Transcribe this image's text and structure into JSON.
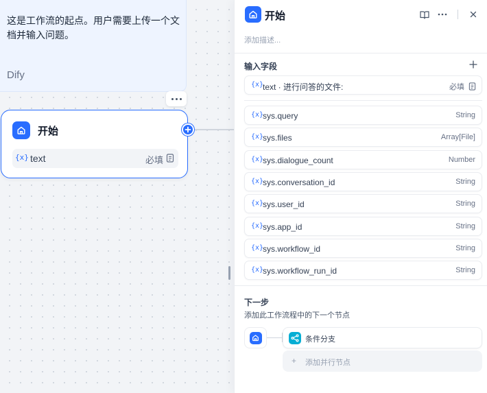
{
  "canvas": {
    "note": {
      "text": "这是工作流的起点。用户需要上传一个文档并输入问题。",
      "author": "Dify"
    },
    "start_node": {
      "title": "开始",
      "variable": {
        "brace": "{x}",
        "name": "text",
        "required": "必填"
      }
    }
  },
  "panel": {
    "title": "开始",
    "description_placeholder": "添加描述...",
    "input_fields_title": "输入字段",
    "user_field": {
      "brace": "{x}",
      "name": "text · 进行问答的文件:",
      "required": "必填"
    },
    "system_fields": [
      {
        "brace": "{x}",
        "name": "sys.query",
        "type": "String"
      },
      {
        "brace": "{x}",
        "name": "sys.files",
        "type": "Array[File]"
      },
      {
        "brace": "{x}",
        "name": "sys.dialogue_count",
        "type": "Number"
      },
      {
        "brace": "{x}",
        "name": "sys.conversation_id",
        "type": "String"
      },
      {
        "brace": "{x}",
        "name": "sys.user_id",
        "type": "String"
      },
      {
        "brace": "{x}",
        "name": "sys.app_id",
        "type": "String"
      },
      {
        "brace": "{x}",
        "name": "sys.workflow_id",
        "type": "String"
      },
      {
        "brace": "{x}",
        "name": "sys.workflow_run_id",
        "type": "String"
      }
    ],
    "next_step": {
      "title": "下一步",
      "description": "添加此工作流程中的下一个节点",
      "target_label": "条件分支",
      "add_parallel_plus": "+",
      "add_parallel_label": "添加并行节点"
    }
  },
  "icons": {
    "start_node": "home-icon",
    "panel_actions": [
      "book-open-icon",
      "more-horizontal-icon",
      "close-icon"
    ],
    "add": "plus-icon",
    "document": "document-icon",
    "branch": "branch-icon"
  },
  "colors": {
    "accent": "#296dff",
    "branch": "#06aed4",
    "note_bg": "#eef4ff"
  }
}
